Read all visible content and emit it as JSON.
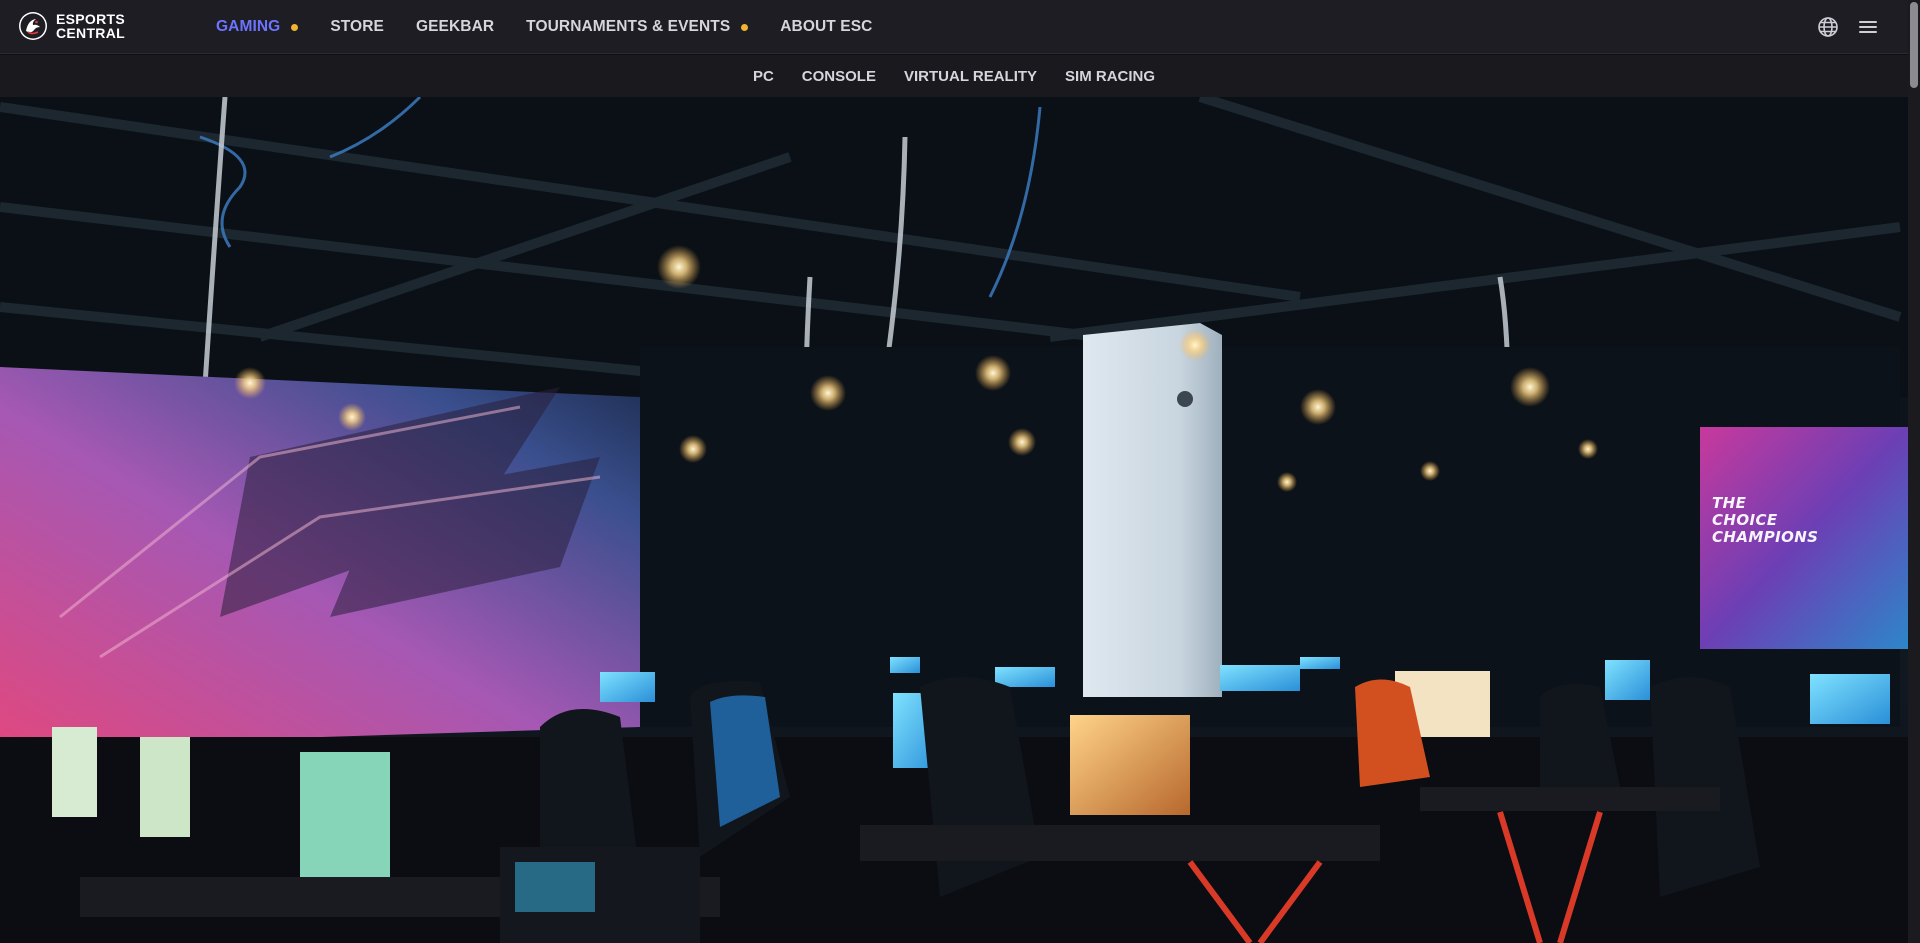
{
  "brand": {
    "line1": "ESPORTS",
    "line2": "CENTRAL"
  },
  "nav": {
    "items": [
      {
        "label": "GAMING",
        "active": true,
        "dot": true
      },
      {
        "label": "STORE",
        "active": false,
        "dot": false
      },
      {
        "label": "GEEKBAR",
        "active": false,
        "dot": false
      },
      {
        "label": "TOURNAMENTS & EVENTS",
        "active": false,
        "dot": true
      },
      {
        "label": "ABOUT ESC",
        "active": false,
        "dot": false
      }
    ],
    "right_icons": [
      "globe-icon",
      "hamburger-menu-icon"
    ]
  },
  "subnav": {
    "items": [
      "PC",
      "CONSOLE",
      "VIRTUAL REALITY",
      "SIM RACING"
    ]
  },
  "hero": {
    "banner_line1": "THE",
    "banner_line2": "CHOICE",
    "banner_line3": "CHAMPIONS"
  },
  "colors": {
    "active_nav": "#6c73ff",
    "dot": "#f2b32e",
    "topbar": "#1e1d23",
    "subbar": "#1a191e"
  }
}
